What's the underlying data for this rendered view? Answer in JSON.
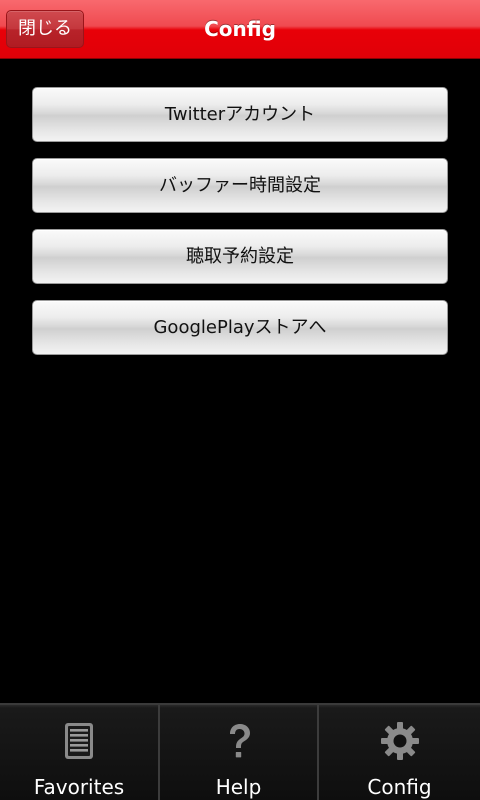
{
  "header": {
    "close_label": "閉じる",
    "title": "Config"
  },
  "menu": {
    "items": [
      {
        "label": "Twitterアカウント"
      },
      {
        "label": "バッファー時間設定"
      },
      {
        "label": "聴取予約設定"
      },
      {
        "label": "GooglePlayストアへ"
      }
    ]
  },
  "tabbar": {
    "tabs": [
      {
        "label": "Favorites",
        "icon": "list-icon"
      },
      {
        "label": "Help",
        "icon": "question-icon"
      },
      {
        "label": "Config",
        "icon": "gear-icon",
        "selected": true
      }
    ]
  },
  "colors": {
    "header_red": "#e80008",
    "background": "#000000",
    "button_gray": "#e0e0e0",
    "tab_icon_gray": "#8a8a8a"
  }
}
